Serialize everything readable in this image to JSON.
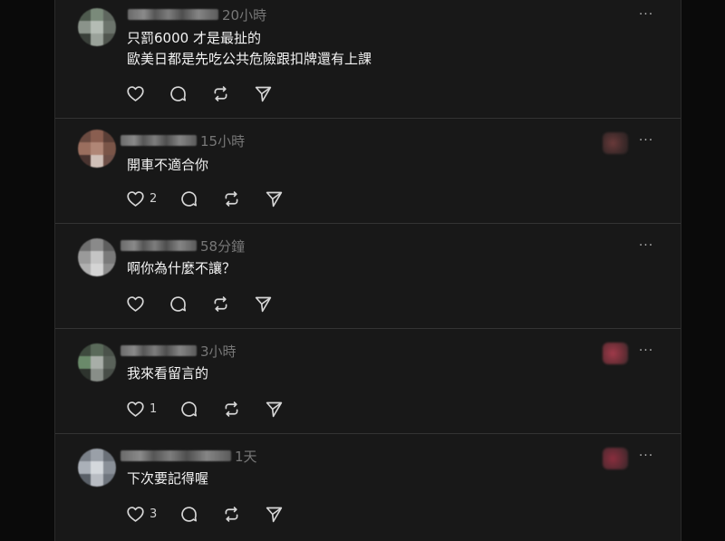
{
  "posts": [
    {
      "time": "20小時",
      "lines": [
        "只罰6000 才是最扯的",
        "歐美日都是先吃公共危險跟扣牌還有上課"
      ],
      "likes": "",
      "more_icon": "more-icon",
      "badge": null
    },
    {
      "time": "15小時",
      "lines": [
        "開車不適合你"
      ],
      "likes": "2",
      "more_icon": "more-icon",
      "badge": "#5a3a3a"
    },
    {
      "time": "58分鐘",
      "lines": [
        "啊你為什麼不讓？"
      ],
      "likes": "",
      "more_icon": "more-icon",
      "badge": null
    },
    {
      "time": "3小時",
      "lines": [
        "我來看留言的"
      ],
      "likes": "1",
      "more_icon": "more-icon",
      "badge": "#8a2f3a"
    },
    {
      "time": "1天",
      "lines": [
        "下次要記得喔"
      ],
      "likes": "3",
      "more_icon": "more-icon",
      "badge": "#7a2f3a"
    }
  ],
  "more_label": "···",
  "colors": {
    "background": "#0a0a0a",
    "panel": "#181818",
    "divider": "#333333",
    "text": "#f3f3f3",
    "muted": "#777777"
  }
}
